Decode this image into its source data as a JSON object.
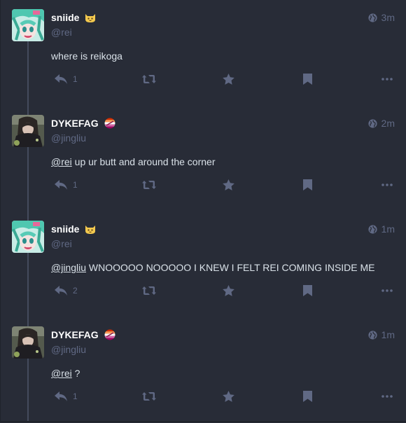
{
  "thread": [
    {
      "display_name": "sniide",
      "emoji": "cat-emoji",
      "handle": "@rei",
      "time": "3m",
      "content_parts": [
        {
          "type": "text",
          "value": "where is reikoga"
        }
      ],
      "replies": "1"
    },
    {
      "display_name": "DYKEFAG",
      "emoji": "flag-emoji",
      "handle": "@jingliu",
      "time": "2m",
      "content_parts": [
        {
          "type": "mention",
          "value": "@rei"
        },
        {
          "type": "text",
          "value": " up ur butt and around the corner"
        }
      ],
      "replies": "1"
    },
    {
      "display_name": "sniide",
      "emoji": "cat-emoji",
      "handle": "@rei",
      "time": "1m",
      "content_parts": [
        {
          "type": "mention",
          "value": "@jingliu"
        },
        {
          "type": "text",
          "value": " WNOOOOO NOOOOO I KNEW I FELT REI COMING INSIDE ME"
        }
      ],
      "replies": "2"
    },
    {
      "display_name": "DYKEFAG",
      "emoji": "flag-emoji",
      "handle": "@jingliu",
      "time": "1m",
      "content_parts": [
        {
          "type": "mention",
          "value": "@rei"
        },
        {
          "type": "text",
          "value": " ?"
        }
      ],
      "replies": "1"
    }
  ],
  "colors": {
    "background": "#282c37",
    "muted": "#606984",
    "text": "#d9e1e8",
    "name": "#ffffff"
  },
  "icons": [
    "globe-icon",
    "reply-icon",
    "boost-icon",
    "star-icon",
    "bookmark-icon",
    "ellipsis-icon"
  ]
}
